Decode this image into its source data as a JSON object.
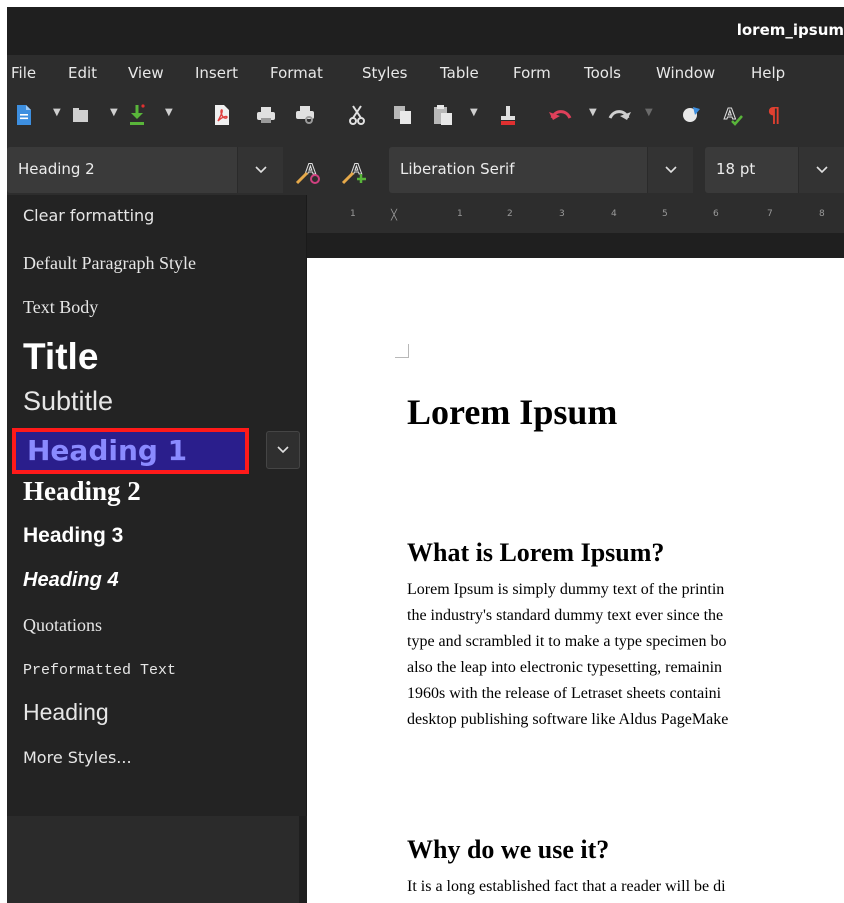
{
  "window": {
    "title": "lorem_ipsum"
  },
  "menu": [
    "File",
    "Edit",
    "View",
    "Insert",
    "Format",
    "Styles",
    "Table",
    "Form",
    "Tools",
    "Window",
    "Help"
  ],
  "formatting": {
    "paragraph_style": "Heading 2",
    "font_name": "Liberation Serif",
    "font_size": "18 pt"
  },
  "ruler": {
    "ticks": [
      "1",
      "1",
      "2",
      "3",
      "4",
      "5",
      "6",
      "7",
      "8"
    ]
  },
  "styles_dropdown": {
    "items": [
      "Clear formatting",
      "Default Paragraph Style",
      "Text Body",
      "Title",
      "Subtitle",
      "Heading 1",
      "Heading 2",
      "Heading 3",
      "Heading 4",
      "Quotations",
      "Preformatted Text",
      "Heading",
      "More Styles..."
    ],
    "highlighted": "Heading 1"
  },
  "document": {
    "title": "Lorem Ipsum",
    "section1_heading": "What is Lorem Ipsum?",
    "section1_lines": [
      "Lorem Ipsum is simply dummy text of the printin",
      "the industry's standard dummy text ever since the",
      "type and scrambled it to make a type specimen bo",
      "also the leap into electronic typesetting, remainin",
      "1960s with the release of Letraset sheets containi",
      "desktop publishing software like Aldus PageMake"
    ],
    "section2_heading": "Why do we use it?",
    "section2_lines": [
      "It is a long established fact that a reader will be di"
    ]
  },
  "colors": {
    "highlight_fill": "#2a1e8c",
    "highlight_border": "#ff1a1a",
    "highlight_text": "#8a8aff"
  }
}
